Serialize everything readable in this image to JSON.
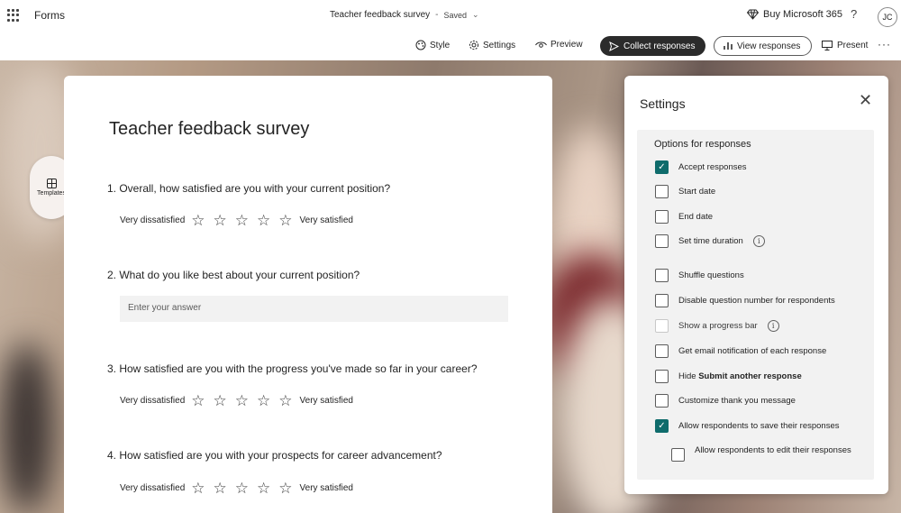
{
  "topbar": {
    "app_name": "Forms",
    "doc_title": "Teacher feedback survey",
    "separator": "-",
    "save_status": "Saved",
    "buy_label": "Buy Microsoft 365",
    "help_label": "?",
    "avatar_initials": "JC"
  },
  "toolbar": {
    "style": "Style",
    "settings": "Settings",
    "preview": "Preview",
    "collect": "Collect responses",
    "view_responses": "View responses",
    "present": "Present",
    "more": "···"
  },
  "templates_label": "Templates",
  "form": {
    "title": "Teacher feedback survey",
    "questions": [
      {
        "text": "1. Overall, how satisfied are you with your current position?",
        "low": "Very dissatisfied",
        "high": "Very satisfied",
        "stars": 5
      },
      {
        "text": "2. What do you like best about your current position?",
        "placeholder": "Enter your answer"
      },
      {
        "text": "3. How satisfied are you with the progress you've made so far in your career?",
        "low": "Very dissatisfied",
        "high": "Very satisfied",
        "stars": 5
      },
      {
        "text": "4. How satisfied are you with your prospects for career advancement?",
        "low": "Very dissatisfied",
        "high": "Very satisfied",
        "stars": 5
      }
    ]
  },
  "settings": {
    "title": "Settings",
    "section": "Options for responses",
    "options": [
      {
        "label": "Accept responses",
        "checked": true
      },
      {
        "label": "Start date",
        "checked": false
      },
      {
        "label": "End date",
        "checked": false
      },
      {
        "label": "Set time duration",
        "checked": false,
        "info": true
      },
      {
        "label": "Shuffle questions",
        "checked": false
      },
      {
        "label": "Disable question number for respondents",
        "checked": false
      },
      {
        "label": "Show a progress bar",
        "checked": false,
        "disabled": true,
        "info": true
      },
      {
        "label": "Get email notification of each response",
        "checked": false
      },
      {
        "label_prefix": "Hide ",
        "label_bold": "Submit another response",
        "checked": false
      },
      {
        "label": "Customize thank you message",
        "checked": false
      },
      {
        "label": "Allow respondents to save their responses",
        "checked": true
      }
    ],
    "sub_option": {
      "label": "Allow respondents to edit their responses",
      "checked": false
    }
  },
  "colors": {
    "accent": "#0f6c6c",
    "collect_bg": "#2b2b2b"
  }
}
